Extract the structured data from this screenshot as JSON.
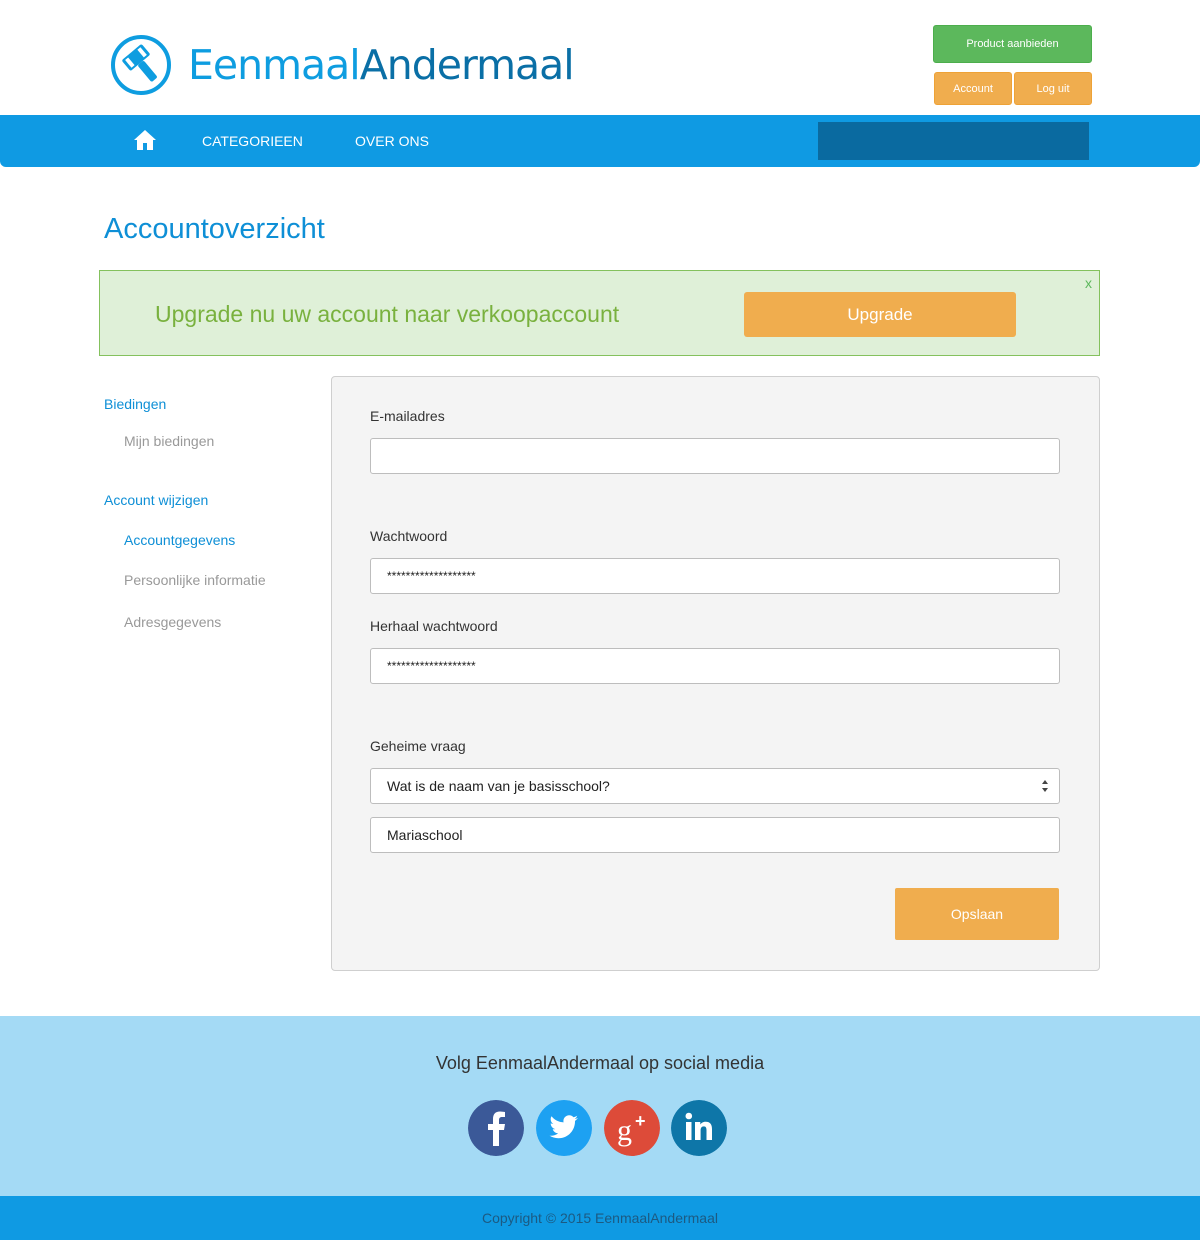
{
  "brand": {
    "part1": "Eenmaal",
    "part2": "Andermaal"
  },
  "header": {
    "product_button": "Product aanbieden",
    "account_button": "Account",
    "logout_button": "Log uit"
  },
  "nav": {
    "categories": "CATEGORIEEN",
    "about": "OVER ONS",
    "search_value": ""
  },
  "page_title": "Accountoverzicht",
  "banner": {
    "text": "Upgrade nu uw account naar verkoopaccount",
    "button": "Upgrade",
    "close": "x"
  },
  "sidebar": {
    "bids_heading": "Biedingen",
    "my_bids": "Mijn biedingen",
    "edit_heading": "Account wijzigen",
    "account_details": "Accountgegevens",
    "personal_info": "Persoonlijke informatie",
    "address": "Adresgegevens"
  },
  "form": {
    "email_label": "E-mailadres",
    "email_value": "",
    "password_label": "Wachtwoord",
    "password_value": "*******************",
    "repeat_label": "Herhaal wachtwoord",
    "repeat_value": "*******************",
    "secret_label": "Geheime vraag",
    "secret_question": "Wat is de naam van je basisschool?",
    "secret_answer": "Mariaschool",
    "save_button": "Opslaan"
  },
  "footer": {
    "follow_text": "Volg EenmaalAndermaal op social media",
    "copyright": "Copyright © 2015 EenmaalAndermaal"
  },
  "colors": {
    "primary": "#0f9ae3",
    "orange": "#f0ad4e",
    "green": "#5cb85c",
    "facebook": "#3b5998",
    "twitter": "#1da1f2",
    "googleplus": "#dd4b39",
    "linkedin": "#0e76a8"
  }
}
